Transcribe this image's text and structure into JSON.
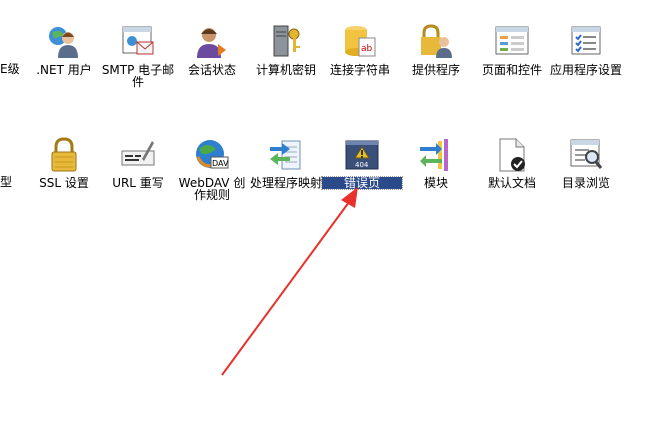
{
  "left_edge_labels": [
    "E级",
    "型"
  ],
  "row1": [
    {
      "name": "dotnet-users",
      "icon": "users-globe-icon",
      "label": ".NET 用户"
    },
    {
      "name": "smtp-email",
      "icon": "email-window-icon",
      "label": "SMTP 电子邮件"
    },
    {
      "name": "session-state",
      "icon": "user-session-icon",
      "label": "会话状态"
    },
    {
      "name": "machine-key",
      "icon": "server-key-icon",
      "label": "计算机密钥"
    },
    {
      "name": "connection-strings",
      "icon": "database-ab-icon",
      "label": "连接字符串"
    },
    {
      "name": "providers",
      "icon": "lock-user-icon",
      "label": "提供程序"
    },
    {
      "name": "pages-controls",
      "icon": "window-list-icon",
      "label": "页面和控件"
    },
    {
      "name": "app-settings",
      "icon": "checklist-icon",
      "label": "应用程序设置"
    }
  ],
  "row2": [
    {
      "name": "ssl-settings",
      "icon": "padlock-icon",
      "label": "SSL 设置"
    },
    {
      "name": "url-rewrite",
      "icon": "pen-rewrite-icon",
      "label": "URL 重写"
    },
    {
      "name": "webdav-authoring",
      "icon": "dav-globe-icon",
      "label": "WebDAV 创作规则"
    },
    {
      "name": "handler-mappings",
      "icon": "arrows-mapping-icon",
      "label": "处理程序映射"
    },
    {
      "name": "error-pages",
      "icon": "error-404-icon",
      "label": "错误页",
      "badge": "404"
    },
    {
      "name": "modules",
      "icon": "modules-arrows-icon",
      "label": "模块"
    },
    {
      "name": "default-document",
      "icon": "document-check-icon",
      "label": "默认文档"
    },
    {
      "name": "directory-browsing",
      "icon": "magnifier-list-icon",
      "label": "目录浏览"
    }
  ],
  "annotation": {
    "color": "#e8312a"
  }
}
